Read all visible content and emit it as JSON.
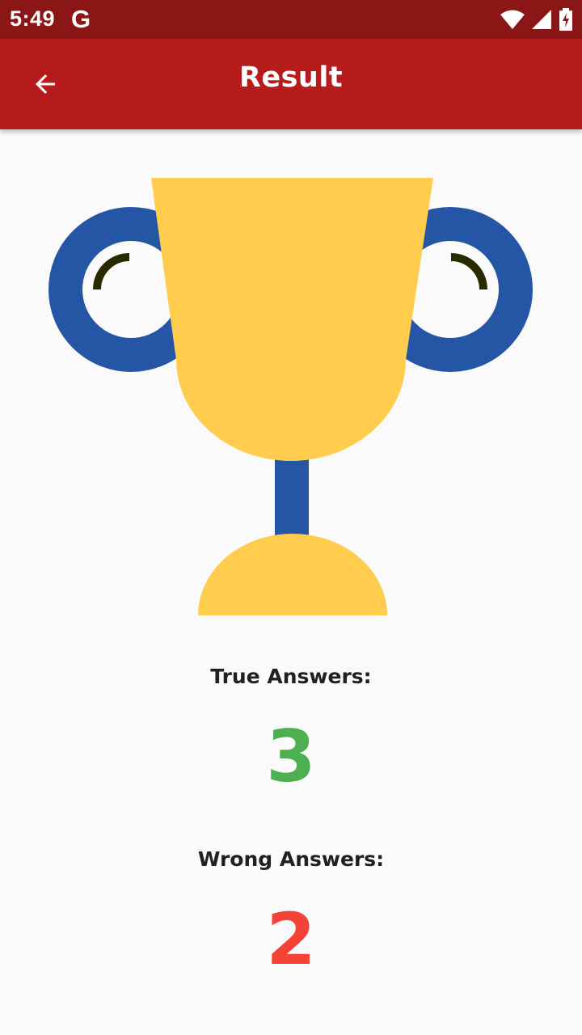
{
  "status_bar": {
    "time": "5:49",
    "notification_icon": "google-g-icon",
    "icons": [
      "wifi-icon",
      "cell-signal-icon",
      "battery-charging-icon"
    ]
  },
  "app_bar": {
    "title": "Result",
    "back_icon": "arrow-back-icon"
  },
  "trophy": {
    "icon": "trophy-icon",
    "colors": {
      "cup": "#ffcc4d",
      "handles": "#2556a6",
      "handle_shine": "#2a2a00"
    }
  },
  "results": {
    "true_label": "True Answers:",
    "true_value": "3",
    "true_color": "#4caf50",
    "wrong_label": "Wrong Answers:",
    "wrong_value": "2",
    "wrong_color": "#f44336"
  },
  "colors": {
    "status_bar": "#8b1616",
    "app_bar": "#b71c1c",
    "background": "#fafafa"
  }
}
